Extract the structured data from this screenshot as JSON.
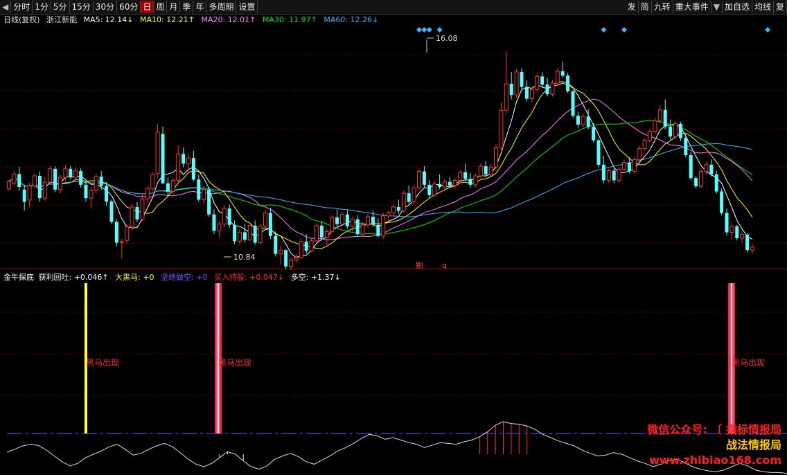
{
  "toolbar": {
    "left": [
      "分时",
      "1分",
      "5分",
      "15分",
      "30分",
      "60分",
      "日",
      "周",
      "月",
      "季",
      "年",
      "多周期",
      "设置"
    ],
    "active": "日",
    "right": [
      "发",
      "简",
      "九转",
      "重大事件",
      "加自选",
      "均线",
      "复"
    ]
  },
  "legend": {
    "period": "日线(复权)",
    "stock": "浙江新能",
    "ma5": "MA5: 12.14↓",
    "ma10": "MA10: 12.21↑",
    "ma20": "MA20: 12.01↑",
    "ma30": "MA30: 11.97↑",
    "ma60": "MA60: 12.26↓"
  },
  "colors": {
    "up": "#ff3232",
    "down": "#54ffff",
    "ma5": "#ffffff",
    "ma10": "#ffff00",
    "ma20": "#ff80ff",
    "ma30": "#00e600",
    "ma60": "#3cb4ff",
    "marker": "#3cb4ff",
    "grid": "#7a0000"
  },
  "main_annotations": {
    "high": "16.08",
    "low": "10.84",
    "misc1": "剔",
    "misc2": "q"
  },
  "indicator": {
    "name": "金牛探底",
    "profit": "获利回吐: +0.046↑",
    "bigblack": "大黑马: +0",
    "short": "坚绝做空: +0",
    "buy": "买入持股: +0.047↓",
    "duokong": "多空: +1.37↓",
    "signal_label": "黑马出现"
  },
  "watermark": {
    "l1": "微信公众号: 〔 指标情报局",
    "l2": "战法情报局",
    "l3": "www.zhibiao168.com"
  },
  "chart_data": {
    "type": "candlestick",
    "price_range": [
      10.5,
      16.6
    ],
    "n_candles": 152,
    "ohlc": [
      [
        12.37,
        12.62,
        12.32,
        12.57
      ],
      [
        12.52,
        12.84,
        12.47,
        12.77
      ],
      [
        12.77,
        12.97,
        12.32,
        12.42
      ],
      [
        12.35,
        12.48,
        11.78,
        12.02
      ],
      [
        12.07,
        12.52,
        11.88,
        12.45
      ],
      [
        12.45,
        12.78,
        12.38,
        12.72
      ],
      [
        12.72,
        12.84,
        12.02,
        12.12
      ],
      [
        12.12,
        12.68,
        12.05,
        12.55
      ],
      [
        12.55,
        12.98,
        12.48,
        12.91
      ],
      [
        12.91,
        12.98,
        12.28,
        12.35
      ],
      [
        12.35,
        12.75,
        12.25,
        12.68
      ],
      [
        12.68,
        13.02,
        12.58,
        12.91
      ],
      [
        12.91,
        12.98,
        12.62,
        12.68
      ],
      [
        12.68,
        12.95,
        12.55,
        12.85
      ],
      [
        12.85,
        12.92,
        12.4,
        12.48
      ],
      [
        12.48,
        12.62,
        12.02,
        12.12
      ],
      [
        12.12,
        12.4,
        11.85,
        12.33
      ],
      [
        12.33,
        12.78,
        12.25,
        12.7
      ],
      [
        12.7,
        12.85,
        12.35,
        12.45
      ],
      [
        12.45,
        12.55,
        11.92,
        12.03
      ],
      [
        12.03,
        12.08,
        11.42,
        11.48
      ],
      [
        11.48,
        11.55,
        10.82,
        10.92
      ],
      [
        10.92,
        11.02,
        10.5,
        10.95
      ],
      [
        10.98,
        11.42,
        10.88,
        11.35
      ],
      [
        11.35,
        11.98,
        11.25,
        11.88
      ],
      [
        11.88,
        12.02,
        11.48,
        11.55
      ],
      [
        11.55,
        12.22,
        11.5,
        12.1
      ],
      [
        12.1,
        12.45,
        11.98,
        12.38
      ],
      [
        12.38,
        12.82,
        12.3,
        12.76
      ],
      [
        12.78,
        14.12,
        12.68,
        13.9
      ],
      [
        13.85,
        14.05,
        12.5,
        12.52
      ],
      [
        12.52,
        12.68,
        12.18,
        12.3
      ],
      [
        12.3,
        12.66,
        12.22,
        12.6
      ],
      [
        12.6,
        13.55,
        12.55,
        13.31
      ],
      [
        13.31,
        13.48,
        12.95,
        13.05
      ],
      [
        13.05,
        13.32,
        12.78,
        13.2
      ],
      [
        13.2,
        13.4,
        12.58,
        12.62
      ],
      [
        12.62,
        12.75,
        12.02,
        12.08
      ],
      [
        12.08,
        12.44,
        11.98,
        12.35
      ],
      [
        12.35,
        12.42,
        11.62,
        11.68
      ],
      [
        11.68,
        11.82,
        11.16,
        11.24
      ],
      [
        11.24,
        11.5,
        11.05,
        11.42
      ],
      [
        11.42,
        11.92,
        11.34,
        11.84
      ],
      [
        11.84,
        11.95,
        11.32,
        11.4
      ],
      [
        11.4,
        11.52,
        10.88,
        10.96
      ],
      [
        10.96,
        11.28,
        10.86,
        11.2
      ],
      [
        11.2,
        11.42,
        10.92,
        11.0
      ],
      [
        11.0,
        11.46,
        10.96,
        11.38
      ],
      [
        11.38,
        11.52,
        10.86,
        10.92
      ],
      [
        10.92,
        11.42,
        10.86,
        11.36
      ],
      [
        11.36,
        11.8,
        11.3,
        11.72
      ],
      [
        11.72,
        11.86,
        11.02,
        11.1
      ],
      [
        11.1,
        11.22,
        10.55,
        10.62
      ],
      [
        10.62,
        10.84,
        10.35,
        10.72
      ],
      [
        10.72,
        10.75,
        10.2,
        10.28
      ],
      [
        10.28,
        10.52,
        10.18,
        10.45
      ],
      [
        10.45,
        10.62,
        10.38,
        10.52
      ],
      [
        10.52,
        11.02,
        10.48,
        10.95
      ],
      [
        10.95,
        11.15,
        10.62,
        10.7
      ],
      [
        10.7,
        11.04,
        10.66,
        10.97
      ],
      [
        10.97,
        11.45,
        10.92,
        11.38
      ],
      [
        11.38,
        11.5,
        10.98,
        11.06
      ],
      [
        11.06,
        11.3,
        10.86,
        11.22
      ],
      [
        11.22,
        11.66,
        11.18,
        11.6
      ],
      [
        11.6,
        11.82,
        11.34,
        11.42
      ],
      [
        11.42,
        11.75,
        11.36,
        11.68
      ],
      [
        11.68,
        11.8,
        11.3,
        11.36
      ],
      [
        11.36,
        11.62,
        11.22,
        11.55
      ],
      [
        11.55,
        11.66,
        11.08,
        11.15
      ],
      [
        11.15,
        11.48,
        11.08,
        11.4
      ],
      [
        11.4,
        11.7,
        11.32,
        11.62
      ],
      [
        11.62,
        11.78,
        11.34,
        11.4
      ],
      [
        11.4,
        11.58,
        11.05,
        11.1
      ],
      [
        11.1,
        11.72,
        11.02,
        11.64
      ],
      [
        11.64,
        11.78,
        11.52,
        11.72
      ],
      [
        11.72,
        11.96,
        11.62,
        11.88
      ],
      [
        11.88,
        12.08,
        11.7,
        11.78
      ],
      [
        11.78,
        12.32,
        11.72,
        12.25
      ],
      [
        12.25,
        12.46,
        11.96,
        12.02
      ],
      [
        12.02,
        12.48,
        11.94,
        12.4
      ],
      [
        12.4,
        12.9,
        12.34,
        12.84
      ],
      [
        12.84,
        12.98,
        12.4,
        12.48
      ],
      [
        12.48,
        12.62,
        12.12,
        12.2
      ],
      [
        12.2,
        12.58,
        12.14,
        12.5
      ],
      [
        12.5,
        12.76,
        12.36,
        12.42
      ],
      [
        12.42,
        12.64,
        12.3,
        12.56
      ],
      [
        12.56,
        12.7,
        12.4,
        12.46
      ],
      [
        12.46,
        12.66,
        12.36,
        12.6
      ],
      [
        12.6,
        12.88,
        12.52,
        12.82
      ],
      [
        12.82,
        13.05,
        12.58,
        12.64
      ],
      [
        12.64,
        12.8,
        12.4,
        12.48
      ],
      [
        12.48,
        12.78,
        12.42,
        12.72
      ],
      [
        12.72,
        13.05,
        12.66,
        12.98
      ],
      [
        12.98,
        13.12,
        12.7,
        12.76
      ],
      [
        12.76,
        13.04,
        12.7,
        12.96
      ],
      [
        12.96,
        13.58,
        12.9,
        13.48
      ],
      [
        13.48,
        14.7,
        13.42,
        14.48
      ],
      [
        14.48,
        16.08,
        14.4,
        15.2
      ],
      [
        15.2,
        15.52,
        14.78,
        14.9
      ],
      [
        14.9,
        15.6,
        14.82,
        15.52
      ],
      [
        15.52,
        15.62,
        15.05,
        15.12
      ],
      [
        15.12,
        15.3,
        14.72,
        14.8
      ],
      [
        14.8,
        15.12,
        14.7,
        15.05
      ],
      [
        15.05,
        15.48,
        14.98,
        15.4
      ],
      [
        15.4,
        15.52,
        15.1,
        15.18
      ],
      [
        15.18,
        15.36,
        14.86,
        14.92
      ],
      [
        14.92,
        15.3,
        14.86,
        15.22
      ],
      [
        15.22,
        15.62,
        15.14,
        15.54
      ],
      [
        15.54,
        15.8,
        15.36,
        15.42
      ],
      [
        15.42,
        15.5,
        14.96,
        15.0
      ],
      [
        15.0,
        15.04,
        14.28,
        14.34
      ],
      [
        14.34,
        14.44,
        14.02,
        14.1
      ],
      [
        14.1,
        14.4,
        14.02,
        14.32
      ],
      [
        14.32,
        14.52,
        13.98,
        14.04
      ],
      [
        14.04,
        14.14,
        13.62,
        13.68
      ],
      [
        13.68,
        13.72,
        12.96,
        13.02
      ],
      [
        13.02,
        13.26,
        12.52,
        12.6
      ],
      [
        12.6,
        12.92,
        12.52,
        12.86
      ],
      [
        12.86,
        12.92,
        12.52,
        12.6
      ],
      [
        12.6,
        12.96,
        12.54,
        12.9
      ],
      [
        12.9,
        13.16,
        12.84,
        13.08
      ],
      [
        13.08,
        13.22,
        12.78,
        12.84
      ],
      [
        12.84,
        13.24,
        12.78,
        13.16
      ],
      [
        13.16,
        13.52,
        13.1,
        13.46
      ],
      [
        13.46,
        13.74,
        13.4,
        13.68
      ],
      [
        13.68,
        13.98,
        13.6,
        13.92
      ],
      [
        13.92,
        14.28,
        13.86,
        14.2
      ],
      [
        14.2,
        14.62,
        14.12,
        14.5
      ],
      [
        14.5,
        14.78,
        13.98,
        14.05
      ],
      [
        14.05,
        14.24,
        13.7,
        13.78
      ],
      [
        13.78,
        14.2,
        13.72,
        14.12
      ],
      [
        14.12,
        14.18,
        13.66,
        13.74
      ],
      [
        13.74,
        13.84,
        13.22,
        13.28
      ],
      [
        13.28,
        13.36,
        12.6,
        12.66
      ],
      [
        12.66,
        12.72,
        12.38,
        12.44
      ],
      [
        12.44,
        12.92,
        12.38,
        12.84
      ],
      [
        12.84,
        13.1,
        12.76,
        13.02
      ],
      [
        13.02,
        13.16,
        12.7,
        12.76
      ],
      [
        12.76,
        12.86,
        12.24,
        12.3
      ],
      [
        12.3,
        12.38,
        11.66,
        11.72
      ],
      [
        11.72,
        11.84,
        11.12,
        11.2
      ],
      [
        11.2,
        11.42,
        11.02,
        11.36
      ],
      [
        11.36,
        11.4,
        10.98,
        11.04
      ],
      [
        11.04,
        11.2,
        10.92,
        11.14
      ],
      [
        11.14,
        11.18,
        10.66,
        10.72
      ],
      [
        10.72,
        10.88,
        10.62,
        10.8
      ]
    ],
    "indicator_range": [
      -0.5,
      1.5
    ],
    "indicator_line": [
      0.05,
      0.12,
      0.2,
      0.24,
      0.21,
      0.1,
      -0.04,
      -0.18,
      -0.28,
      -0.22,
      -0.08,
      0.0,
      0.08,
      0.18,
      0.24,
      0.12,
      -0.02,
      0.02,
      0.12,
      0.2,
      0.26,
      0.18,
      0.04,
      -0.12,
      -0.24,
      -0.3,
      -0.22,
      -0.08,
      0.06,
      0.0,
      -0.16,
      -0.3,
      -0.36,
      -0.28,
      -0.12,
      -0.04,
      0.02,
      -0.06,
      -0.18,
      -0.24,
      -0.14,
      -0.04,
      0.08,
      0.16,
      0.26,
      0.38,
      0.48,
      0.44,
      0.36,
      0.4,
      0.34,
      0.28,
      0.24,
      0.16,
      0.22,
      0.28,
      0.26,
      0.24,
      0.3,
      0.34,
      0.42,
      0.54,
      0.7,
      0.78,
      0.74,
      0.72,
      0.68,
      0.6,
      0.48,
      0.4,
      0.32,
      0.26,
      0.2,
      0.1,
      0.02,
      -0.04,
      -0.02,
      0.04,
      0.0,
      -0.08,
      -0.16,
      -0.22,
      -0.3,
      -0.24,
      -0.16,
      -0.12,
      -0.2,
      -0.3,
      -0.36,
      -0.4,
      -0.42,
      -0.38,
      -0.3,
      -0.22,
      -0.28,
      -0.38,
      -0.42,
      -0.44,
      -0.44,
      -0.46
    ],
    "signal_positions": [
      17,
      45,
      152
    ],
    "signal_colors": [
      "#ffff33",
      "#ff3bd0",
      "#ff3bd0"
    ]
  }
}
